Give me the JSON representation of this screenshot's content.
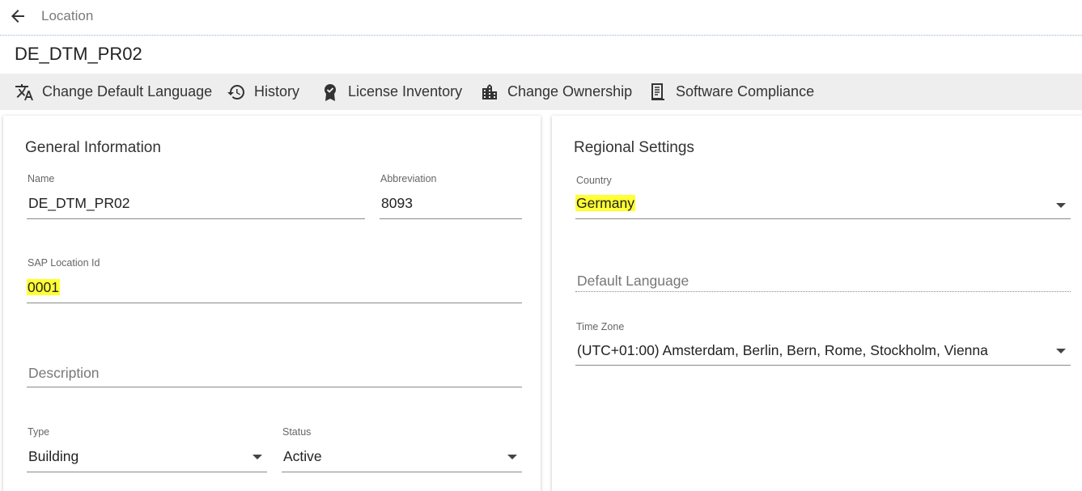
{
  "header": {
    "back_icon": "arrow-left-icon",
    "title": "Location"
  },
  "record": {
    "title": "DE_DTM_PR02"
  },
  "toolbar": {
    "items": [
      {
        "icon": "translate-icon",
        "label": "Change Default Language"
      },
      {
        "icon": "history-icon",
        "label": "History"
      },
      {
        "icon": "license-badge-icon",
        "label": "License Inventory"
      },
      {
        "icon": "building-icon",
        "label": "Change Ownership"
      },
      {
        "icon": "compliance-document-icon",
        "label": "Software Compliance"
      }
    ]
  },
  "general": {
    "title": "General Information",
    "name": {
      "label": "Name",
      "value": "DE_DTM_PR02"
    },
    "abbreviation": {
      "label": "Abbreviation",
      "value": "8093"
    },
    "sap_location_id": {
      "label": "SAP Location Id",
      "value": "0001"
    },
    "description": {
      "placeholder": "Description"
    },
    "type": {
      "label": "Type",
      "value": "Building"
    },
    "status": {
      "label": "Status",
      "value": "Active"
    }
  },
  "regional": {
    "title": "Regional Settings",
    "country": {
      "label": "Country",
      "value": "Germany"
    },
    "default_language": {
      "placeholder": "Default Language"
    },
    "time_zone": {
      "label": "Time Zone",
      "value": "(UTC+01:00) Amsterdam, Berlin, Bern, Rome, Stockholm, Vienna"
    }
  },
  "colors": {
    "highlight": "#ffff33",
    "toolbar_bg": "#eeeeee"
  }
}
